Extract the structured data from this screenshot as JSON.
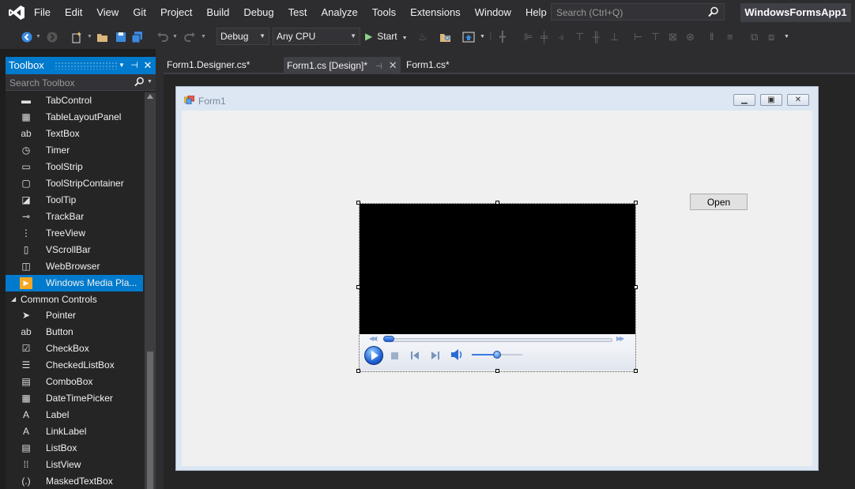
{
  "menubar": {
    "items": [
      "File",
      "Edit",
      "View",
      "Git",
      "Project",
      "Build",
      "Debug",
      "Test",
      "Analyze",
      "Tools",
      "Extensions",
      "Window",
      "Help"
    ],
    "search_placeholder": "Search (Ctrl+Q)",
    "solution_name": "WindowsFormsApp1"
  },
  "toolbar": {
    "configuration": "Debug",
    "platform": "Any CPU",
    "start_label": "Start"
  },
  "toolbox": {
    "title": "Toolbox",
    "search_placeholder": "Search Toolbox",
    "items_top": [
      {
        "label": "TabControl",
        "icon": "tabcontrol-icon",
        "glyph": "▬"
      },
      {
        "label": "TableLayoutPanel",
        "icon": "tablelayoutpanel-icon",
        "glyph": "▦"
      },
      {
        "label": "TextBox",
        "icon": "textbox-icon",
        "glyph": "ab"
      },
      {
        "label": "Timer",
        "icon": "timer-icon",
        "glyph": "◷"
      },
      {
        "label": "ToolStrip",
        "icon": "toolstrip-icon",
        "glyph": "▭"
      },
      {
        "label": "ToolStripContainer",
        "icon": "toolstripcontainer-icon",
        "glyph": "▢"
      },
      {
        "label": "ToolTip",
        "icon": "tooltip-icon",
        "glyph": "◪"
      },
      {
        "label": "TrackBar",
        "icon": "trackbar-icon",
        "glyph": "⊸"
      },
      {
        "label": "TreeView",
        "icon": "treeview-icon",
        "glyph": "⋮"
      },
      {
        "label": "VScrollBar",
        "icon": "vscrollbar-icon",
        "glyph": "▯"
      },
      {
        "label": "WebBrowser",
        "icon": "webbrowser-icon",
        "glyph": "◫"
      },
      {
        "label": "Windows Media Pla...",
        "icon": "windows-media-player-icon",
        "glyph": "▶",
        "selected": true
      }
    ],
    "group_label": "Common Controls",
    "items_common": [
      {
        "label": "Pointer",
        "icon": "pointer-icon",
        "glyph": "➤"
      },
      {
        "label": "Button",
        "icon": "button-icon",
        "glyph": "ab"
      },
      {
        "label": "CheckBox",
        "icon": "checkbox-icon",
        "glyph": "☑"
      },
      {
        "label": "CheckedListBox",
        "icon": "checkedlistbox-icon",
        "glyph": "☰"
      },
      {
        "label": "ComboBox",
        "icon": "combobox-icon",
        "glyph": "▤"
      },
      {
        "label": "DateTimePicker",
        "icon": "datetimepicker-icon",
        "glyph": "▦"
      },
      {
        "label": "Label",
        "icon": "label-icon",
        "glyph": "A"
      },
      {
        "label": "LinkLabel",
        "icon": "linklabel-icon",
        "glyph": "A"
      },
      {
        "label": "ListBox",
        "icon": "listbox-icon",
        "glyph": "▤"
      },
      {
        "label": "ListView",
        "icon": "listview-icon",
        "glyph": "⁞⁞"
      },
      {
        "label": "MaskedTextBox",
        "icon": "maskedtextbox-icon",
        "glyph": "(.)"
      }
    ]
  },
  "tabs": [
    {
      "label": "Form1.Designer.cs*",
      "active": false
    },
    {
      "label": "Form1.cs [Design]*",
      "active": true
    },
    {
      "label": "Form1.cs*",
      "active": false
    }
  ],
  "form": {
    "title": "Form1",
    "open_button_label": "Open"
  },
  "colors": {
    "accent": "#007acc",
    "ide_background": "#1e1e1e",
    "chrome": "#2d2d30"
  }
}
